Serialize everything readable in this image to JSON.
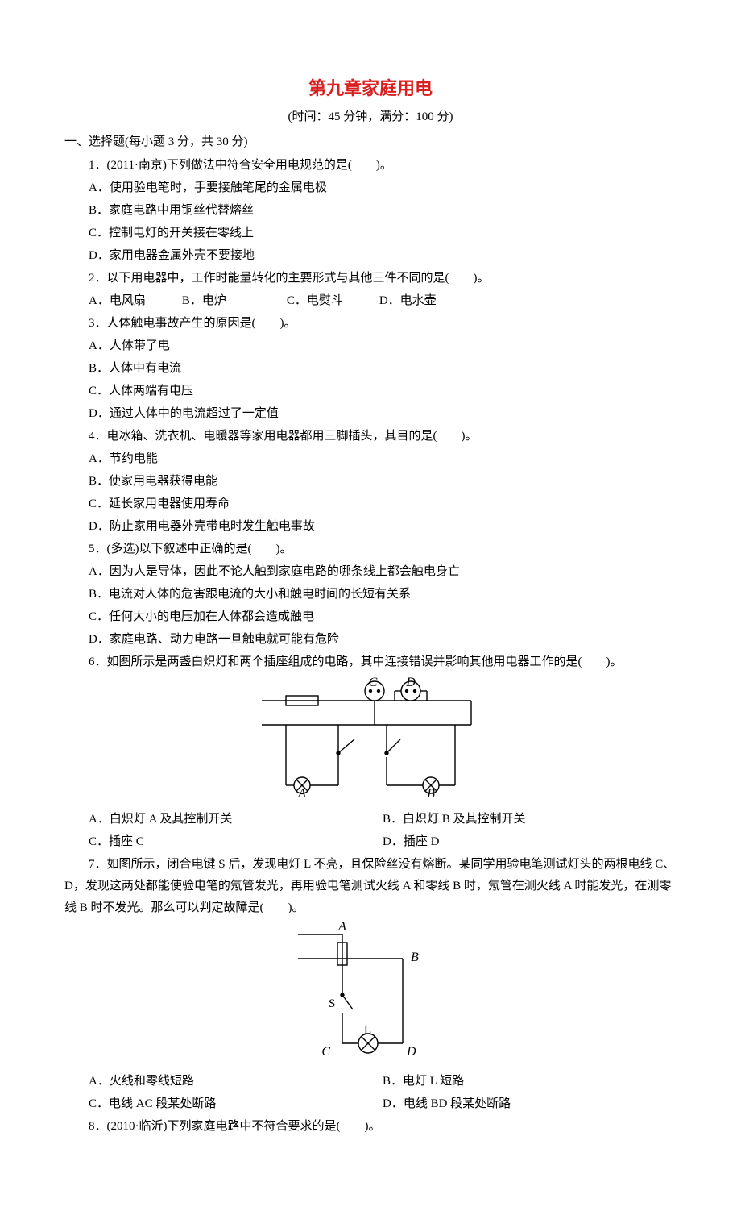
{
  "title": "第九章家庭用电",
  "subtitle": "(时间：45 分钟，满分：100 分)",
  "section1": "一、选择题(每小题 3 分，共 30 分)",
  "q1": {
    "stem": "1．(2011·南京)下列做法中符合安全用电规范的是(　　)。",
    "a": "A．使用验电笔时，手要接触笔尾的金属电极",
    "b": "B．家庭电路中用铜丝代替熔丝",
    "c": "C．控制电灯的开关接在零线上",
    "d": "D．家用电器金属外壳不要接地"
  },
  "q2": {
    "stem": "2．以下用电器中，工作时能量转化的主要形式与其他三件不同的是(　　)。",
    "opts": "A．电风扇　　　B．电炉　　　　　C．电熨斗　　　D．电水壶"
  },
  "q3": {
    "stem": "3．人体触电事故产生的原因是(　　)。",
    "a": "A．人体带了电",
    "b": "B．人体中有电流",
    "c": "C．人体两端有电压",
    "d": "D．通过人体中的电流超过了一定值"
  },
  "q4": {
    "stem": "4．电冰箱、洗衣机、电暖器等家用电器都用三脚插头，其目的是(　　)。",
    "a": "A．节约电能",
    "b": "B．使家用电器获得电能",
    "c": "C．延长家用电器使用寿命",
    "d": "D．防止家用电器外壳带电时发生触电事故"
  },
  "q5": {
    "stem": "5．(多选)以下叙述中正确的是(　　)。",
    "a": "A．因为人是导体，因此不论人触到家庭电路的哪条线上都会触电身亡",
    "b": "B．电流对人体的危害跟电流的大小和触电时间的长短有关系",
    "c": "C．任何大小的电压加在人体都会造成触电",
    "d": "D．家庭电路、动力电路一旦触电就可能有危险"
  },
  "q6": {
    "stem": "6．如图所示是两盏白炽灯和两个插座组成的电路，其中连接错误并影响其他用电器工作的是(　　)。",
    "a": "A．白炽灯 A 及其控制开关",
    "b": "B．白炽灯 B 及其控制开关",
    "c": "C．插座 C",
    "d": "D．插座 D",
    "labels": {
      "A": "A",
      "B": "B",
      "C": "C",
      "D": "D"
    }
  },
  "q7": {
    "stem": "7．如图所示，闭合电键 S 后，发现电灯 L 不亮，且保险丝没有熔断。某同学用验电笔测试灯头的两根电线 C、D，发现这两处都能使验电笔的氖管发光，再用验电笔测试火线 A 和零线 B 时，氖管在测火线 A 时能发光，在测零线 B 时不发光。那么可以判定故障是(　　)。",
    "a": "A．火线和零线短路",
    "b": "B．电灯 L 短路",
    "c": "C．电线 AC 段某处断路",
    "d": "D．电线 BD 段某处断路",
    "labels": {
      "A": "A",
      "B": "B",
      "C": "C",
      "D": "D",
      "S": "S",
      "L": "L"
    }
  },
  "q8": {
    "stem": "8．(2010·临沂)下列家庭电路中不符合要求的是(　　)。"
  }
}
